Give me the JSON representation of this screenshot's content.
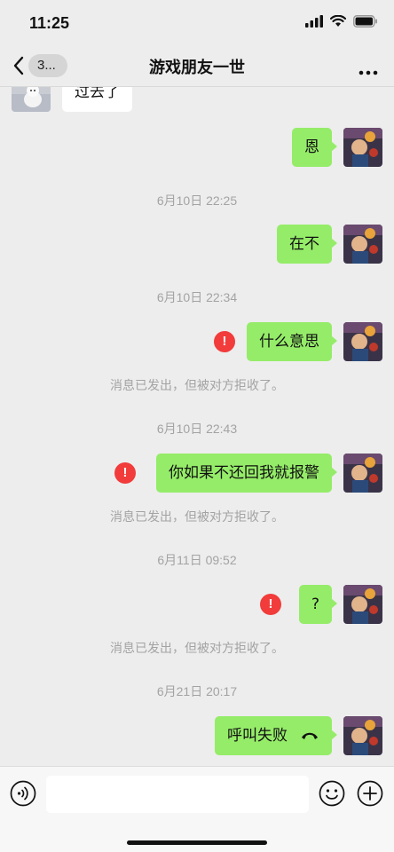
{
  "status": {
    "time": "11:25"
  },
  "nav": {
    "back_count": "3...",
    "title": "游戏朋友一世"
  },
  "messages": {
    "m0": "过去了",
    "m1": "恩",
    "t1": "6月10日 22:25",
    "m2": "在不",
    "t2": "6月10日 22:34",
    "m3": "什么意思",
    "s3": "消息已发出，但被对方拒收了。",
    "t3": "6月10日 22:43",
    "m4": "你如果不还回我就报警",
    "s4": "消息已发出，但被对方拒收了。",
    "t4": "6月11日 09:52",
    "m5": "?",
    "s5": "消息已发出，但被对方拒收了。",
    "t5": "6月21日 20:17",
    "m6": "呼叫失败",
    "error_mark": "!"
  },
  "colors": {
    "my_bubble": "#95ec69",
    "background": "#ededed",
    "error": "#f23b3b"
  },
  "icons": [
    "signal-icon",
    "wifi-icon",
    "battery-icon",
    "back-chevron-icon",
    "more-icon",
    "voice-icon",
    "emoji-icon",
    "plus-icon",
    "call-icon"
  ]
}
